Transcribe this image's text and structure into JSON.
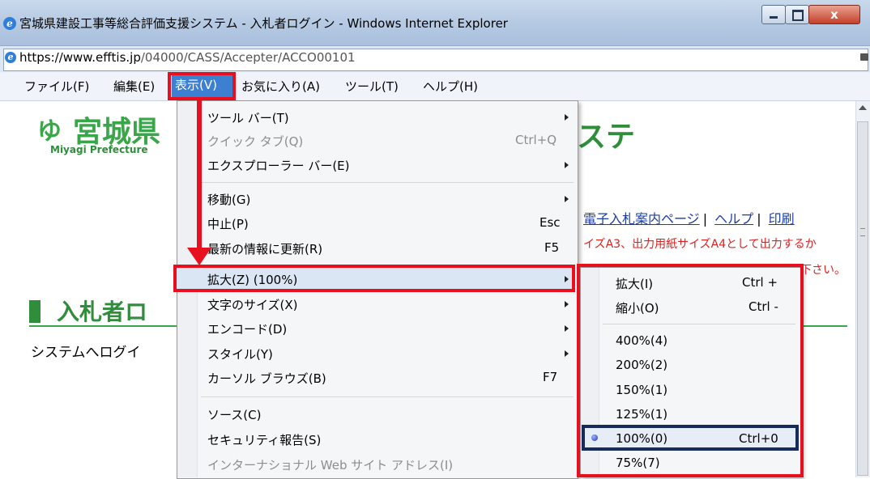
{
  "window": {
    "title": "宮城県建設工事等総合評価支援システム - 入札者ログイン - Windows Internet Explorer",
    "close_glyph": "x"
  },
  "address_bar": {
    "host": "https://www.efftis.jp",
    "path": "/04000/CASS/Accepter/ACCO00101"
  },
  "menu_bar": {
    "items": [
      "ファイル(F)",
      "編集(E)",
      "表示(V)",
      "お気に入り(A)",
      "ツール(T)",
      "ヘルプ(H)"
    ]
  },
  "page": {
    "logo_text": "宮城県",
    "logo_sub": "Miyagi Prefecture",
    "title_fragment": "ステ",
    "nav_links": [
      "電子入札案内ページ",
      "ヘルプ",
      "印刷"
    ],
    "notice_line1": "イズA3、出力用紙サイズA4として出力するか",
    "notice_line2": "下さい。",
    "section_title": "入札者ロ",
    "login_desc": "システムへログイ"
  },
  "view_menu": {
    "items": [
      {
        "label": "ツール バー(T)",
        "shortcut": "",
        "submenu": true,
        "disabled": false
      },
      {
        "label": "クイック タブ(Q)",
        "shortcut": "Ctrl+Q",
        "submenu": false,
        "disabled": true
      },
      {
        "label": "エクスプローラー バー(E)",
        "shortcut": "",
        "submenu": true,
        "disabled": false
      },
      {
        "label": "移動(G)",
        "shortcut": "",
        "submenu": true,
        "disabled": false
      },
      {
        "label": "中止(P)",
        "shortcut": "Esc",
        "submenu": false,
        "disabled": false
      },
      {
        "label": "最新の情報に更新(R)",
        "shortcut": "F5",
        "submenu": false,
        "disabled": false
      },
      {
        "label": "拡大(Z) (100%)",
        "shortcut": "",
        "submenu": true,
        "disabled": false
      },
      {
        "label": "文字のサイズ(X)",
        "shortcut": "",
        "submenu": true,
        "disabled": false
      },
      {
        "label": "エンコード(D)",
        "shortcut": "",
        "submenu": true,
        "disabled": false
      },
      {
        "label": "スタイル(Y)",
        "shortcut": "",
        "submenu": true,
        "disabled": false
      },
      {
        "label": "カーソル ブラウズ(B)",
        "shortcut": "F7",
        "submenu": false,
        "disabled": false
      },
      {
        "label": "ソース(C)",
        "shortcut": "",
        "submenu": false,
        "disabled": false
      },
      {
        "label": "セキュリティ報告(S)",
        "shortcut": "",
        "submenu": false,
        "disabled": false
      },
      {
        "label": "インターナショナル Web サイト アドレス(I)",
        "shortcut": "",
        "submenu": false,
        "disabled": true
      }
    ]
  },
  "zoom_menu": {
    "items": [
      {
        "label": "拡大(I)",
        "shortcut": "Ctrl +",
        "checked": false
      },
      {
        "label": "縮小(O)",
        "shortcut": "Ctrl -",
        "checked": false
      },
      {
        "label": "400%(4)",
        "shortcut": "",
        "checked": false
      },
      {
        "label": "200%(2)",
        "shortcut": "",
        "checked": false
      },
      {
        "label": "150%(1)",
        "shortcut": "",
        "checked": false
      },
      {
        "label": "125%(1)",
        "shortcut": "",
        "checked": false
      },
      {
        "label": "100%(0)",
        "shortcut": "Ctrl+0",
        "checked": true
      },
      {
        "label": "75%(7)",
        "shortcut": "",
        "checked": false
      }
    ]
  },
  "colors": {
    "highlight_red": "#e8101e",
    "selected_navy": "#162a5c",
    "brand_green": "#2f8d3b"
  }
}
